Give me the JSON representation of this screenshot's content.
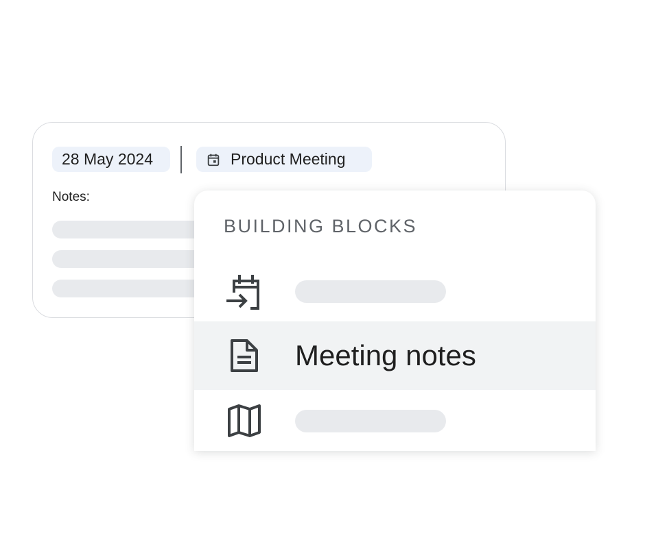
{
  "doc_card": {
    "date_chip": "28 May 2024",
    "event_chip": {
      "label": "Product Meeting",
      "icon": "calendar-event-icon"
    },
    "notes_label": "Notes:"
  },
  "blocks_menu": {
    "heading": "BUILDING BLOCKS",
    "items": [
      {
        "icon": "calendar-import-icon",
        "label": ""
      },
      {
        "icon": "document-icon",
        "label": "Meeting notes",
        "selected": true
      },
      {
        "icon": "map-icon",
        "label": ""
      }
    ]
  },
  "colors": {
    "chip_background": "#edf2fa",
    "selected_row": "#f1f3f4",
    "placeholder": "#e8eaed",
    "heading_text": "#5f6368",
    "icon": "#3c4043"
  }
}
